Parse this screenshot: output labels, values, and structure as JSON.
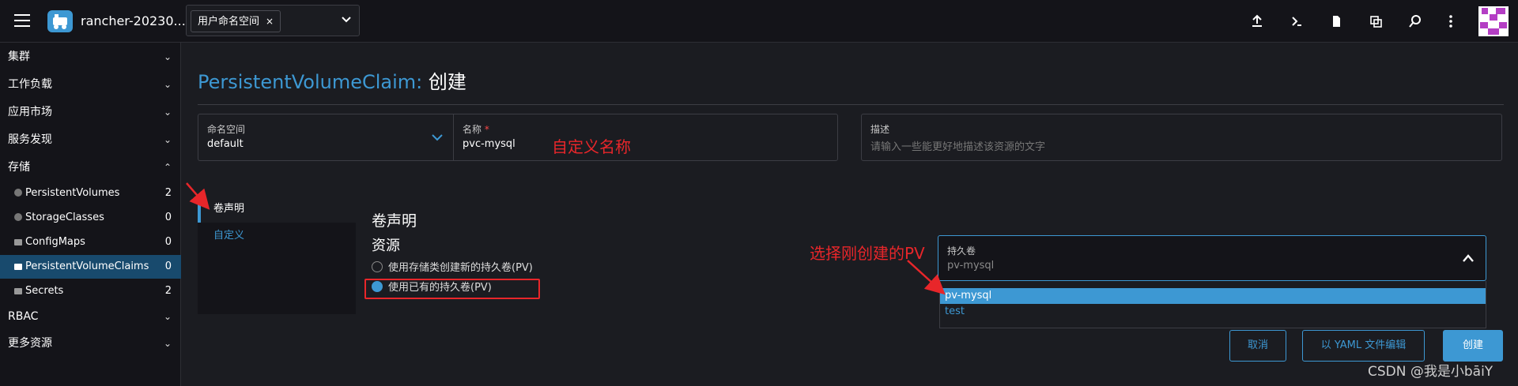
{
  "header": {
    "cluster_name": "rancher-20230...",
    "namespace_filter": {
      "chip_label": "用户命名空间",
      "chip_remove": "×"
    }
  },
  "top_icons": [
    "upload-icon",
    "terminal-icon",
    "file-icon",
    "copy-icon",
    "search-icon",
    "more-vertical-icon"
  ],
  "sidebar": {
    "groups": [
      {
        "label": "集群",
        "expanded": false
      },
      {
        "label": "工作负载",
        "expanded": false
      },
      {
        "label": "应用市场",
        "expanded": false
      },
      {
        "label": "服务发现",
        "expanded": false
      },
      {
        "label": "存储",
        "expanded": true
      },
      {
        "label": "RBAC",
        "expanded": false
      },
      {
        "label": "更多资源",
        "expanded": false
      }
    ],
    "storage_items": [
      {
        "label": "PersistentVolumes",
        "count": "2",
        "icon": "circle-icon"
      },
      {
        "label": "StorageClasses",
        "count": "0",
        "icon": "circle-icon"
      },
      {
        "label": "ConfigMaps",
        "count": "0",
        "icon": "folder-icon"
      },
      {
        "label": "PersistentVolumeClaims",
        "count": "0",
        "icon": "folder-icon",
        "active": true
      },
      {
        "label": "Secrets",
        "count": "2",
        "icon": "folder-icon"
      }
    ]
  },
  "page": {
    "title_kind": "PersistentVolumeClaim:",
    "title_action": "创建"
  },
  "form": {
    "namespace": {
      "label": "命名空间",
      "value": "default"
    },
    "name": {
      "label": "名称",
      "required_mark": "*",
      "value": "pvc-mysql"
    },
    "description": {
      "label": "描述",
      "placeholder": "请输入一些能更好地描述该资源的文字"
    }
  },
  "annotations": {
    "name_note": "自定义名称",
    "pv_note": "选择刚创建的PV"
  },
  "tabs": [
    {
      "label": "卷声明",
      "active": true
    },
    {
      "label": "自定义",
      "active": false
    }
  ],
  "volume_claim": {
    "section_title": "卷声明",
    "resource_title": "资源",
    "options": [
      {
        "label": "使用存储类创建新的持久卷(PV)",
        "checked": false
      },
      {
        "label": "使用已有的持久卷(PV)",
        "checked": true
      }
    ],
    "pv_select": {
      "label": "持久卷",
      "value": "pv-mysql",
      "options": [
        {
          "label": "pv-mysql",
          "selected": true
        },
        {
          "label": "test",
          "selected": false
        }
      ]
    }
  },
  "buttons": {
    "cancel": "取消",
    "edit_yaml": "以 YAML 文件编辑",
    "create": "创建"
  },
  "watermark": "CSDN @我是小bāiY",
  "colors": {
    "accent": "#3d98d3",
    "annotation_red": "#e8262a",
    "background": "#1b1c21",
    "sidebar_bg": "#141419",
    "active_nav": "#184a6d"
  }
}
